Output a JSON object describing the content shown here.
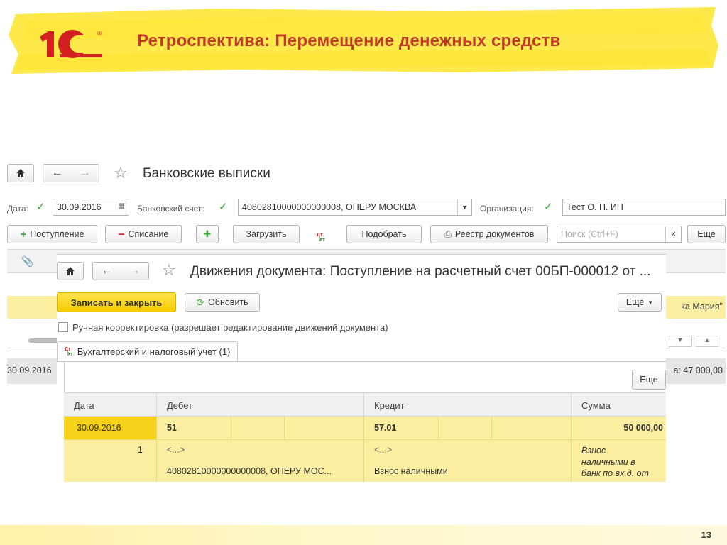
{
  "slide": {
    "title": "Ретроспектива: Перемещение денежных средств",
    "page_number": "13",
    "colors": {
      "title": "#c0392b",
      "logo": "#d21f1f",
      "brush": "#fde94a"
    }
  },
  "bank_window": {
    "title": "Банковские выписки",
    "date_label": "Дата:",
    "date_value": "30.09.2016",
    "account_label": "Банковский счет:",
    "account_value": "40802810000000000008, ОПЕРУ МОСКВА",
    "org_label": "Организация:",
    "org_value": "Тест О. П. ИП",
    "toolbar": {
      "receipt": "Поступление",
      "writeoff": "Списание",
      "load": "Загрузить",
      "pick": "Подобрать",
      "registry": "Реестр документов",
      "search_placeholder": "Поиск (Ctrl+F)",
      "more": "Еще"
    },
    "row_partial_text": "ка Мария\"",
    "bottom_date": "30.09.2016",
    "bottom_total": "а: 47 000,00"
  },
  "movements_window": {
    "title": "Движения документа: Поступление на расчетный счет 00БП-000012 от ...",
    "save_close": "Записать и закрыть",
    "refresh": "Обновить",
    "more": "Еще",
    "manual_label": "Ручная корректировка (разрешает редактирование движений документа)",
    "manual_checked": false,
    "tab_label": "Бухгалтерский и налоговый учет (1)",
    "tab_more": "Еще",
    "icon_dt": "Дт",
    "icon_kt": "Кт",
    "columns": [
      "Дата",
      "Дебет",
      "Кредит",
      "Сумма"
    ],
    "row": {
      "date": "30.09.2016",
      "num": "1",
      "debit": "51",
      "debit_sub": "<...>",
      "debit_account": "40802810000000000008, ОПЕРУ МОС...",
      "credit": "57.01",
      "credit_sub": "<...>",
      "credit_note": "Взнос наличными",
      "sum": "50 000,00",
      "sum_note_1": "Взнос",
      "sum_note_2": "наличными в",
      "sum_note_3": "банк по вх.д.  от"
    }
  }
}
